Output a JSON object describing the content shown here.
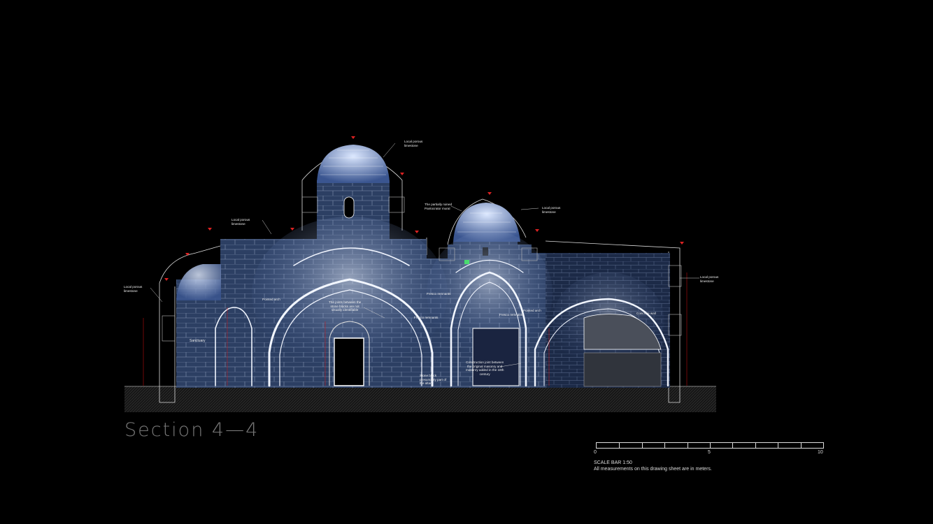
{
  "title": "Section  4—4",
  "scale": {
    "ticks": [
      "0",
      "5",
      "10"
    ],
    "caption_line1": "SCALE BAR 1:50",
    "caption_line2": "All measurements on this drawing sheet are in meters."
  },
  "annotations": {
    "dome_left": "Local porous\nlimestone",
    "dome_right_mural": "The partially ruined\nPantocrator mural",
    "dome_right": "Local porous\nlimestone",
    "roof_left": "Local porous\nlimestone",
    "wall_left": "Local porous\nlimestone",
    "wall_right": "Local porous\nlimestone",
    "pointed_arch_left": "Pointed arch",
    "joints": "The joints between the\nstone blocks are not\nvisually identifiable",
    "fresco_1": "Fresco remnants",
    "fresco_2": "Fresco remnants",
    "fresco_3": "Fresco remnants",
    "pointed_arch_right": "Pointed arch",
    "concrete": "Concrete wall",
    "sanctuary": "Sanctuary",
    "construction": "Construction joint between\nthe original masonry and\nmasonry added in the 18th\ncentury",
    "stone_block": "Stone block\npresumably part of\nthe altar"
  }
}
